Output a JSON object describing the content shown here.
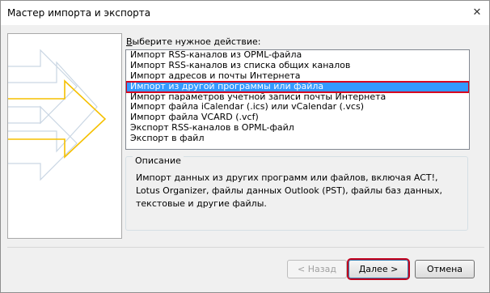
{
  "window": {
    "title": "Мастер импорта и экспорта",
    "close_glyph": "✕"
  },
  "action_prompt": {
    "underlined": "В",
    "rest": "ыберите нужное действие:"
  },
  "actions": {
    "items": [
      {
        "label": "Импорт RSS-каналов из OPML-файла",
        "selected": false
      },
      {
        "label": "Импорт RSS-каналов из списка общих каналов",
        "selected": false
      },
      {
        "label": "Импорт адресов и почты Интернета",
        "selected": false
      },
      {
        "label": "Импорт из другой программы или файла",
        "selected": true
      },
      {
        "label": "Импорт параметров учетной записи почты Интернета",
        "selected": false
      },
      {
        "label": "Импорт файла iCalendar (.ics) или vCalendar (.vcs)",
        "selected": false
      },
      {
        "label": "Импорт файла VCARD (.vcf)",
        "selected": false
      },
      {
        "label": "Экспорт RSS-каналов в OPML-файл",
        "selected": false
      },
      {
        "label": "Экспорт в файл",
        "selected": false
      }
    ]
  },
  "description": {
    "legend": "Описание",
    "text": "Импорт данных из других программ или файлов, включая ACT!, Lotus Organizer, файлы данных Outlook (PST), файлы баз данных, текстовые и другие файлы."
  },
  "buttons": {
    "back": "< Назад",
    "next": "Далее >",
    "cancel": "Отмена"
  },
  "colors": {
    "selection": "#3399ff",
    "highlight_border": "#d8001e",
    "art_accent": "#f5c000"
  }
}
